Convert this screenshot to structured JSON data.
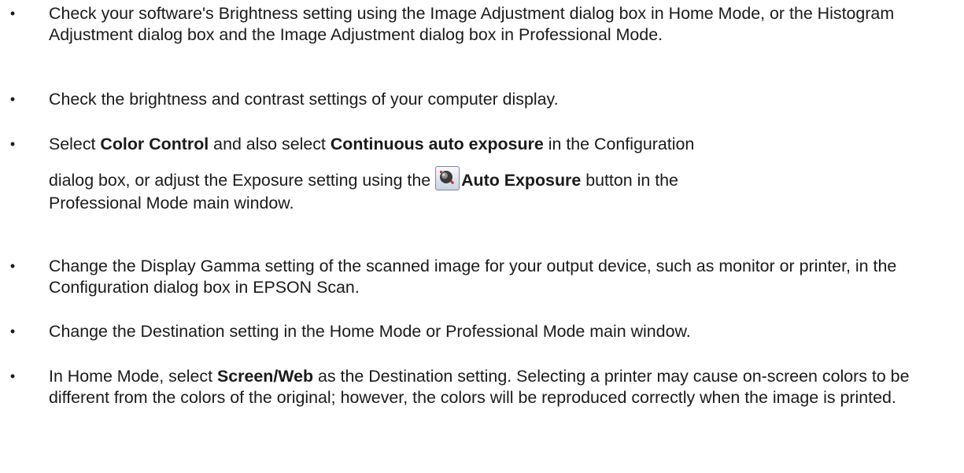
{
  "bullets": [
    {
      "text": "Check your software's Brightness setting using the Image Adjustment dialog box in Home Mode, or the Histogram Adjustment dialog box and the Image Adjustment dialog box in Professional Mode."
    },
    {
      "text": "Check the brightness and contrast settings of your computer display."
    },
    {
      "p1": "Select ",
      "b1": "Color Control",
      "p2": " and also select ",
      "b2": "Continuous auto exposure",
      "p3": " in the Configuration",
      "p4": "dialog box, or adjust the Exposure setting using the ",
      "icon": "auto-exposure-icon",
      "b3": "Auto Exposure",
      "p5": " button in the",
      "p6": "Professional Mode main window."
    },
    {
      "text": "Change the Display Gamma setting of the scanned image for your output device, such as monitor or printer, in the Configuration dialog box in EPSON Scan."
    },
    {
      "text": "Change the Destination setting in the Home Mode or Professional Mode main window."
    },
    {
      "p1": "In Home Mode, select ",
      "b1": "Screen/Web",
      "p2": " as the Destination setting. Selecting a printer may cause on-screen colors to be different from the colors of the original; however, the colors will be reproduced correctly when the image is printed."
    }
  ],
  "bullet_glyph": "•"
}
